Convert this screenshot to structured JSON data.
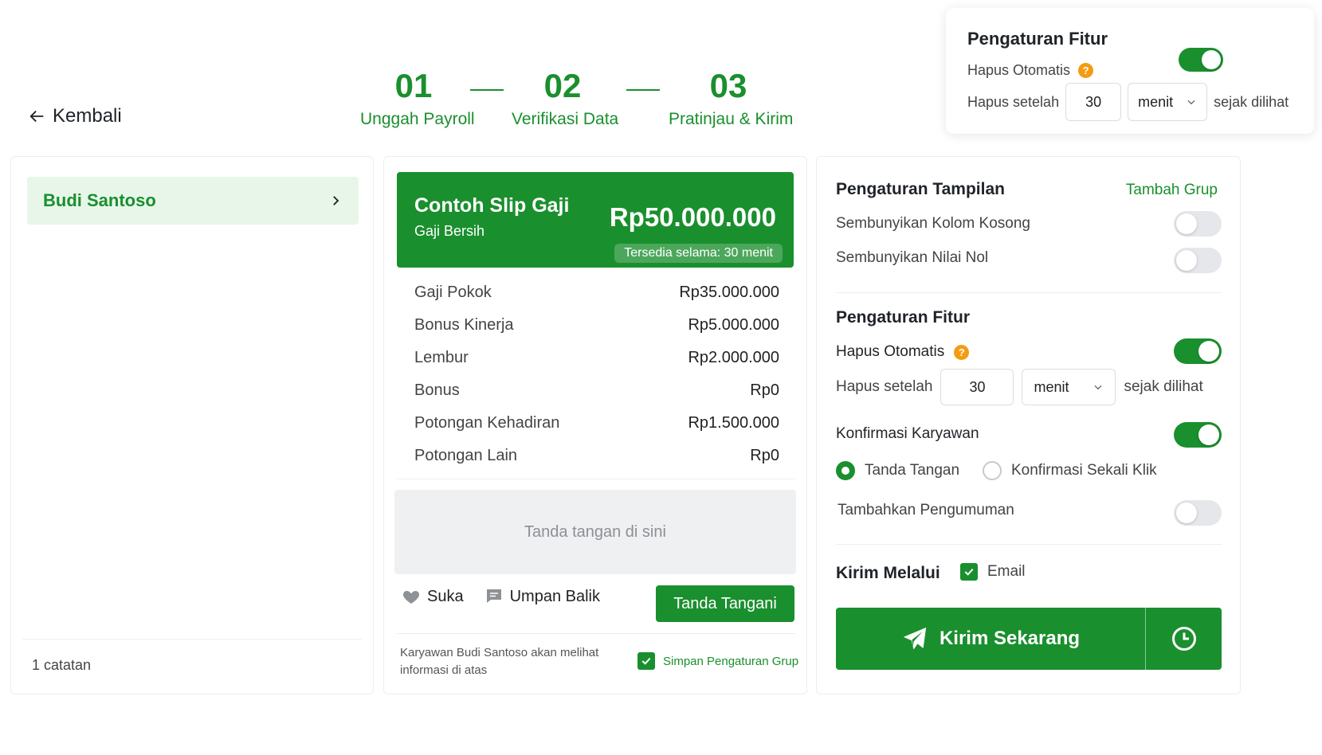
{
  "header": {
    "back_label": "Kembali",
    "steps": [
      {
        "num": "01",
        "label": "Unggah Payroll"
      },
      {
        "num": "02",
        "label": "Verifikasi Data"
      },
      {
        "num": "03",
        "label": "Pratinjau & Kirim"
      }
    ]
  },
  "popup": {
    "title": "Pengaturan Fitur",
    "auto_delete_label": "Hapus Otomatis",
    "auto_delete_on": true,
    "delete_after_label": "Hapus setelah",
    "delete_after_value": "30",
    "unit": "menit",
    "since_seen": "sejak dilihat"
  },
  "left": {
    "employee": "Budi Santoso",
    "count_text": "1 catatan"
  },
  "slip": {
    "title": "Contoh Slip Gaji",
    "subtitle": "Gaji Bersih",
    "amount": "Rp50.000.000",
    "badge": "Tersedia selama: 30 menit",
    "rows": [
      {
        "label": "Gaji Pokok",
        "value": "Rp35.000.000"
      },
      {
        "label": "Bonus Kinerja",
        "value": "Rp5.000.000"
      },
      {
        "label": "Lembur",
        "value": "Rp2.000.000"
      },
      {
        "label": "Bonus",
        "value": "Rp0"
      },
      {
        "label": "Potongan Kehadiran",
        "value": "Rp1.500.000"
      },
      {
        "label": "Potongan Lain",
        "value": "Rp0"
      }
    ],
    "signature_placeholder": "Tanda tangan di sini",
    "like_label": "Suka",
    "feedback_label": "Umpan Balik",
    "sign_button": "Tanda Tangani",
    "note": "Karyawan Budi Santoso akan melihat informasi di atas",
    "save_group_label": "Simpan Pengaturan Grup"
  },
  "right": {
    "display_title": "Pengaturan Tampilan",
    "add_group": "Tambah Grup",
    "hide_empty_cols": "Sembunyikan Kolom Kosong",
    "hide_zero": "Sembunyikan Nilai Nol",
    "feature_title": "Pengaturan Fitur",
    "auto_delete_label": "Hapus Otomatis",
    "delete_after_label": "Hapus setelah",
    "delete_after_value": "30",
    "unit": "menit",
    "since_seen": "sejak dilihat",
    "confirm_label": "Konfirmasi Karyawan",
    "radio_signature": "Tanda Tangan",
    "radio_one_click": "Konfirmasi Sekali Klik",
    "announcement_label": "Tambahkan Pengumuman",
    "send_via_title": "Kirim Melalui",
    "email_label": "Email",
    "send_button": "Kirim Sekarang"
  },
  "colors": {
    "accent": "#1a8f2e",
    "accent_light": "#e8f6ea",
    "help_icon": "#f39c12"
  },
  "icons": [
    "arrow-left-icon",
    "help-icon",
    "chevron-down-icon",
    "chevron-right-icon",
    "heart-icon",
    "comment-icon",
    "check-icon",
    "send-icon",
    "clock-icon"
  ]
}
